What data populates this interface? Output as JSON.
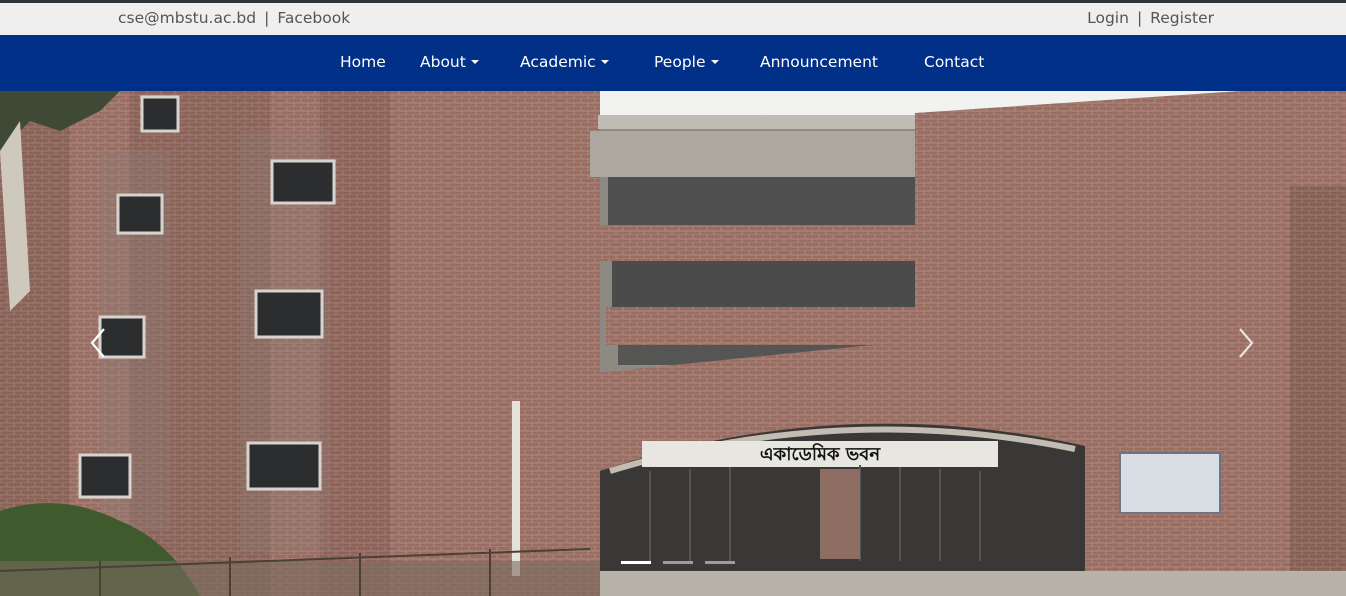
{
  "topbar": {
    "email": "cse@mbstu.ac.bd",
    "facebook": "Facebook",
    "login": "Login",
    "register": "Register",
    "separator": "|"
  },
  "nav": {
    "home": "Home",
    "about": "About",
    "academic": "Academic",
    "people": "People",
    "announcement": "Announcement",
    "contact": "Contact"
  },
  "carousel": {
    "banner_text": "একাডেমিক ভবন",
    "slides": 3,
    "active_slide": 1
  },
  "colors": {
    "navbar": "#003087",
    "topbar": "#efefef",
    "brick": "#9a6a5e"
  },
  "icons": {
    "prev": "chevron-left-icon",
    "next": "chevron-right-icon",
    "dropdown": "caret-down-icon"
  }
}
